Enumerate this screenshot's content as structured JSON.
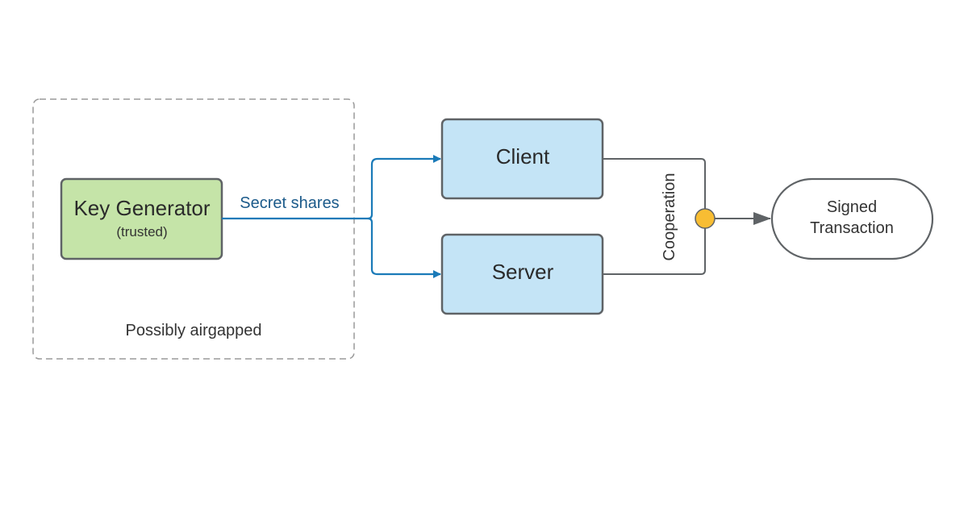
{
  "boundary": {
    "label": "Possibly airgapped"
  },
  "key_generator": {
    "title": "Key Generator",
    "subtitle": "(trusted)",
    "fill": "#c5e4a8"
  },
  "edge_label": "Secret shares",
  "client": {
    "label": "Client"
  },
  "server": {
    "label": "Server"
  },
  "cooperation": {
    "label": "Cooperation"
  },
  "result": {
    "line1": "Signed",
    "line2": "Transaction"
  },
  "colors": {
    "node_fill": "#c4e4f6",
    "edge_blue": "#1a7ab8",
    "edge_label": "#1b5a8a",
    "junction": "#f8bd33",
    "stroke": "#5f6366"
  }
}
